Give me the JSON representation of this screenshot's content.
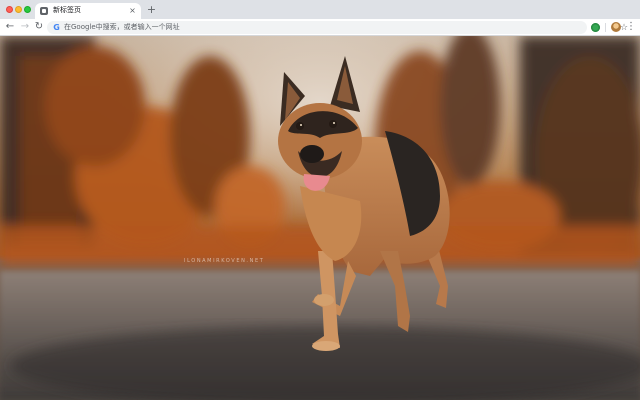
{
  "window": {
    "traffic_lights": [
      "close",
      "minimize",
      "maximize"
    ]
  },
  "tab": {
    "title": "新标签页",
    "close_glyph": "×",
    "favicon": "new-tab-page-icon"
  },
  "new_tab_glyph": "+",
  "toolbar": {
    "back_glyph": "←",
    "forward_glyph": "→",
    "reload_glyph": "↻",
    "search_engine_glyph": "G",
    "omnibox_placeholder": "在Google中搜索，或者输入一个网址",
    "bookmark_glyph": "☆",
    "menu_glyph": "⋮"
  },
  "wallpaper": {
    "subject": "german-shepherd-running",
    "watermark": "ILONAMIRKOVEN.NET"
  },
  "colors": {
    "tabstrip": "#dee1e6",
    "accent_google": "#4285f4",
    "extension_green": "#34a853"
  }
}
